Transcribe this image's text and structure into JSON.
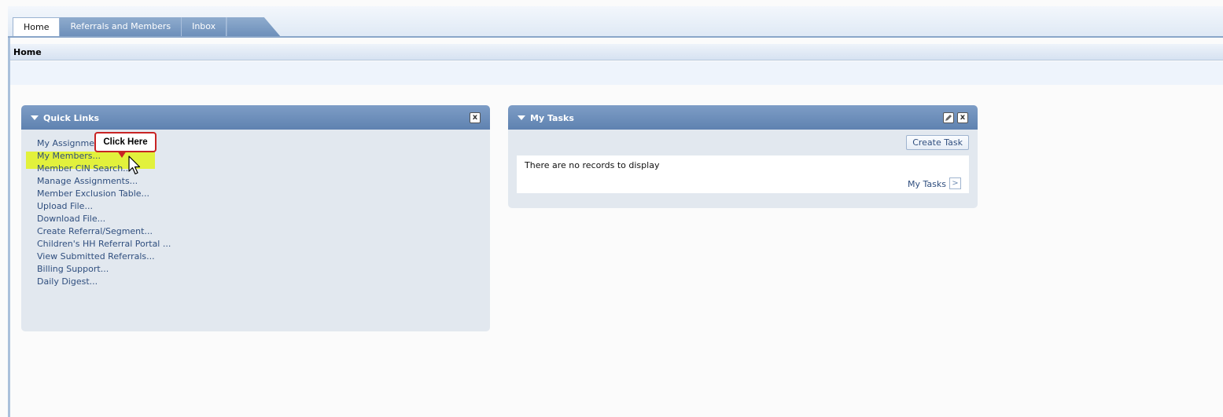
{
  "tabs": [
    {
      "label": "Home",
      "active": true
    },
    {
      "label": "Referrals and Members",
      "active": false
    },
    {
      "label": "Inbox",
      "active": false
    }
  ],
  "page": {
    "title": "Home"
  },
  "quick_links": {
    "title": "Quick Links",
    "close_label": "x",
    "items": [
      "My Assignments...",
      "My Members...",
      "Member CIN Search...",
      "Manage Assignments...",
      "Member Exclusion Table...",
      "Upload File...",
      "Download File...",
      "Create Referral/Segment...",
      "Children's HH Referral Portal ...",
      "View Submitted Referrals...",
      "Billing Support...",
      "Daily Digest..."
    ],
    "highlighted_item": "My Members..."
  },
  "callout": {
    "label": "Click Here"
  },
  "my_tasks": {
    "title": "My Tasks",
    "close_label": "x",
    "create_button": "Create Task",
    "empty_message": "There are no records to display",
    "link_label": "My Tasks",
    "arrow_label": ">"
  },
  "colors": {
    "panel_header": "#6b8cb8",
    "link": "#2f4e7e",
    "highlight": "#e2f13c",
    "callout_border": "#c82424"
  }
}
